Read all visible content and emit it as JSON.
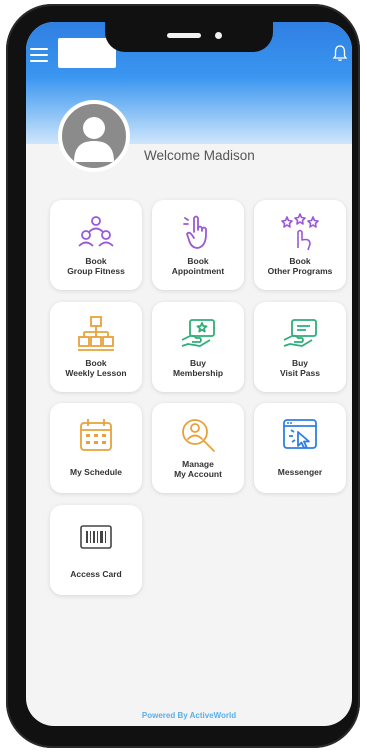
{
  "header": {
    "welcome_text": "Welcome Madison"
  },
  "tiles": [
    {
      "label": "Book\nGroup Fitness",
      "icon": "group-people-icon"
    },
    {
      "label": "Book\nAppointment",
      "icon": "hand-touch-icon"
    },
    {
      "label": "Book\nOther Programs",
      "icon": "stars-hand-icon"
    },
    {
      "label": "Book\nWeekly Lesson",
      "icon": "hierarchy-icon"
    },
    {
      "label": "Buy\nMembership",
      "icon": "hand-card-icon"
    },
    {
      "label": "Buy\nVisit Pass",
      "icon": "hand-pass-icon"
    },
    {
      "label": "My Schedule",
      "icon": "calendar-icon"
    },
    {
      "label": "Manage\nMy Account",
      "icon": "search-user-icon"
    },
    {
      "label": "Messenger",
      "icon": "window-cursor-icon"
    },
    {
      "label": "Access Card",
      "icon": "barcode-icon"
    }
  ],
  "footer": {
    "text": "Powered By ActiveWorld"
  },
  "colors": {
    "header_top": "#2f7fe2",
    "purple": "#9b59d6",
    "green": "#2fae78",
    "orange": "#e7a23a",
    "blue": "#2f7fe2",
    "footer_text": "#5aaee8"
  }
}
